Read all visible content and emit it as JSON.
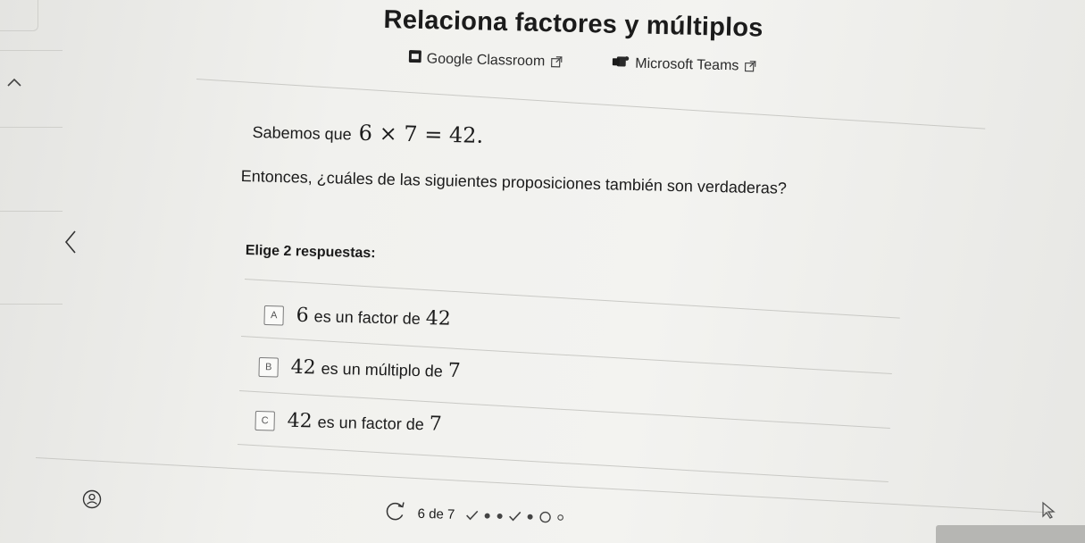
{
  "header": {
    "title": "Relaciona factores y múltiplos",
    "share": [
      {
        "label": "Google Classroom",
        "icon": "google-classroom-icon"
      },
      {
        "label": "Microsoft Teams",
        "icon": "microsoft-teams-icon"
      }
    ]
  },
  "problem": {
    "statement_prefix": "Sabemos que",
    "equation": "6 × 7 = 42.",
    "question": "Entonces, ¿cuáles de las siguientes proposiciones también son verdaderas?",
    "instruction": "Elige 2 respuestas:"
  },
  "options": [
    {
      "letter": "A",
      "number": "6",
      "text": "es un factor de",
      "number2": "42"
    },
    {
      "letter": "B",
      "number": "42",
      "text": "es un múltiplo de",
      "number2": "7"
    },
    {
      "letter": "C",
      "number": "42",
      "text": "es un factor de",
      "number2": "7"
    }
  ],
  "progress": {
    "text": "6 de 7",
    "current": 6,
    "total": 7,
    "marks": [
      "check",
      "dot",
      "dot",
      "check",
      "dot",
      "circle",
      "small-circle"
    ]
  },
  "colors": {
    "text": "#1b1b1b",
    "rule": "#c9c9c5",
    "icon": "#444444"
  }
}
